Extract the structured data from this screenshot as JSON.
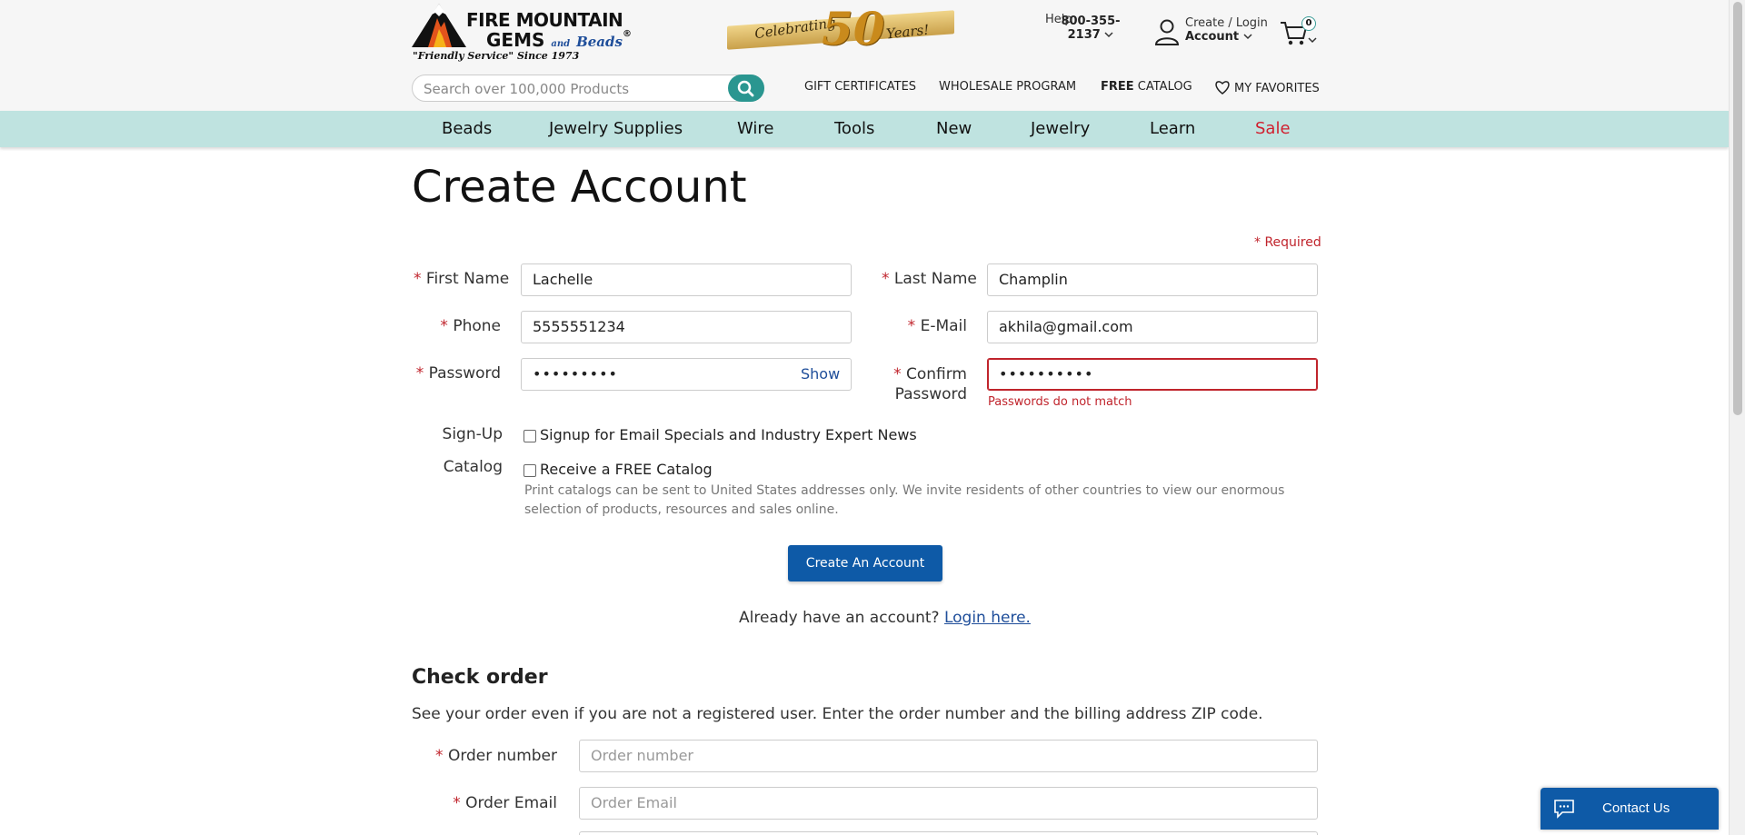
{
  "header": {
    "logo_line1": "FIRE MOUNTAIN",
    "logo_line2": "GEMS",
    "logo_and": "and",
    "logo_beads": "Beads",
    "logo_reg": "®",
    "logo_tagline": "\"Friendly Service\" Since 1973",
    "banner_celebrating": "Celebrating",
    "banner_number": "50",
    "banner_years": "Years!",
    "help_label": "Help",
    "help_phone": "800-355-2137",
    "account_line1": "Create / Login",
    "account_line2": "Account",
    "cart_count": "0",
    "search_placeholder": "Search over 100,000 Products",
    "links": {
      "gift": "GIFT CERTIFICATES",
      "wholesale": "WHOLESALE PROGRAM",
      "free_bold": "FREE",
      "catalog": " CATALOG",
      "favorites": "MY FAVORITES"
    }
  },
  "nav": {
    "items": [
      "Beads",
      "Jewelry Supplies",
      "Wire",
      "Tools",
      "New",
      "Jewelry",
      "Learn",
      "Sale"
    ]
  },
  "form": {
    "title": "Create Account",
    "required_note": "* Required",
    "star": "*",
    "first_name_label": "First Name",
    "first_name_value": "Lachelle",
    "last_name_label": "Last Name",
    "last_name_value": "Champlin",
    "phone_label": "Phone",
    "phone_value": "5555551234",
    "email_label": "E-Mail",
    "email_value": "akhila@gmail.com",
    "password_label": "Password",
    "password_value": "•••••••••",
    "show_label": "Show",
    "confirm_label_1": "Confirm",
    "confirm_label_2": "Password",
    "confirm_value": "••••••••••",
    "confirm_error": "Passwords do not match",
    "signup_label": "Sign-Up",
    "signup_text": "Signup for Email Specials and Industry Expert News",
    "catalog_label": "Catalog",
    "catalog_text": "Receive a FREE Catalog",
    "catalog_note": "Print catalogs can be sent to United States addresses only. We invite residents of other countries to view our enormous selection of products, resources and sales online.",
    "submit_label": "Create An Account",
    "already_text": "Already have an account? ",
    "login_link": "Login here."
  },
  "check_order": {
    "heading": "Check order",
    "description": "See your order even if you are not a registered user. Enter the order number and the billing address ZIP code.",
    "order_number_label": "Order number",
    "order_number_placeholder": "Order number",
    "order_email_label": "Order Email",
    "order_email_placeholder": "Order Email"
  },
  "contact": {
    "label": "Contact Us"
  },
  "colors": {
    "nav_bg": "#bfe3e0",
    "accent_teal": "#2a9690",
    "primary_blue": "#0e5aa7",
    "error_red": "#c0242c",
    "sale_red": "#d11f2e"
  }
}
